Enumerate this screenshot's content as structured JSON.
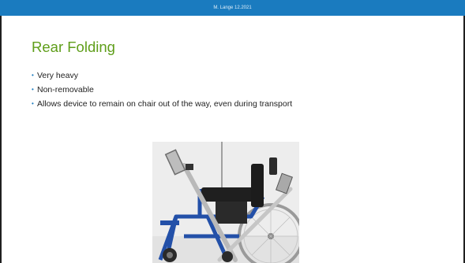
{
  "header": {
    "text": "M. Lange 12.2021"
  },
  "slide": {
    "title": "Rear Folding",
    "bullets": [
      "Very heavy",
      "Non-removable",
      "Allows device to remain on chair out of the way, even during transport"
    ]
  },
  "photo": {
    "icon": "wheelchair-with-mount-photo"
  },
  "colors": {
    "header_bar": "#1a7bbf",
    "title": "#5f9e1a",
    "bullet_marker": "#1a7bbf",
    "body_text": "#222222"
  }
}
